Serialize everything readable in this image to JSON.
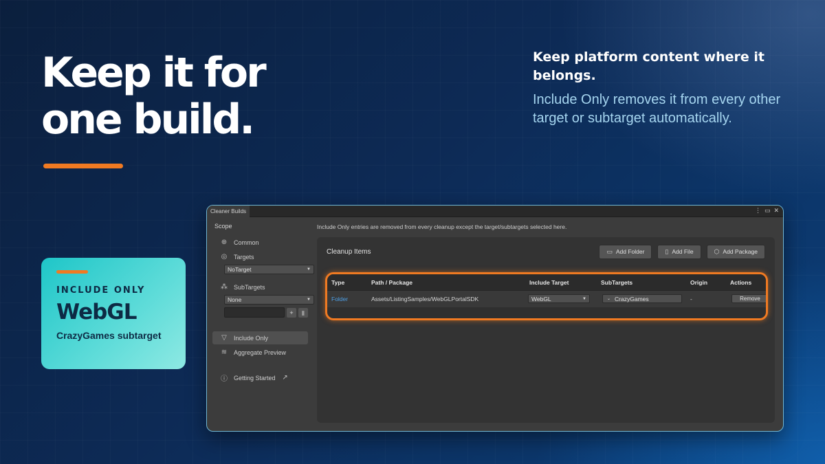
{
  "hero": {
    "headline_line1": "Keep it for",
    "headline_line2": "one build.",
    "side_title": "Keep platform content where it belongs.",
    "side_body": "Include Only removes it from every other target or subtarget automatically."
  },
  "card": {
    "kicker": "INCLUDE ONLY",
    "title": "WebGL",
    "subtitle": "CrazyGames subtarget"
  },
  "colors": {
    "accent": "#f07a22",
    "teal": "#1ec6c8",
    "link": "#4ea0e6"
  },
  "window": {
    "tab_title": "Cleaner Builds",
    "sidebar": {
      "scope_label": "Scope",
      "common_label": "Common",
      "common_icon": "crosshair-icon",
      "targets_label": "Targets",
      "targets_icon": "target-icon",
      "targets_value": "NoTarget",
      "subtargets_label": "SubTargets",
      "subtargets_icon": "hierarchy-icon",
      "subtargets_value": "None",
      "include_only_label": "Include Only",
      "include_only_icon": "filter-icon",
      "aggregate_label": "Aggregate Preview",
      "aggregate_icon": "layers-icon",
      "getting_started_label": "Getting Started",
      "getting_started_icon": "info-icon"
    },
    "info_line": "Include Only entries are removed from every cleanup except the target/subtargets selected here.",
    "panel": {
      "title": "Cleanup Items",
      "add_folder": "Add Folder",
      "add_file": "Add File",
      "add_package": "Add Package"
    },
    "table": {
      "columns": [
        "Type",
        "Path / Package",
        "Include Target",
        "SubTargets",
        "Origin",
        "Actions"
      ],
      "rows": [
        {
          "type": "Folder",
          "path": "Assets/ListingSamples/WebGLPortalSDK",
          "include_target": "WebGL",
          "subtargets": "CrazyGames",
          "origin": "-",
          "action": "Remove"
        }
      ]
    }
  }
}
